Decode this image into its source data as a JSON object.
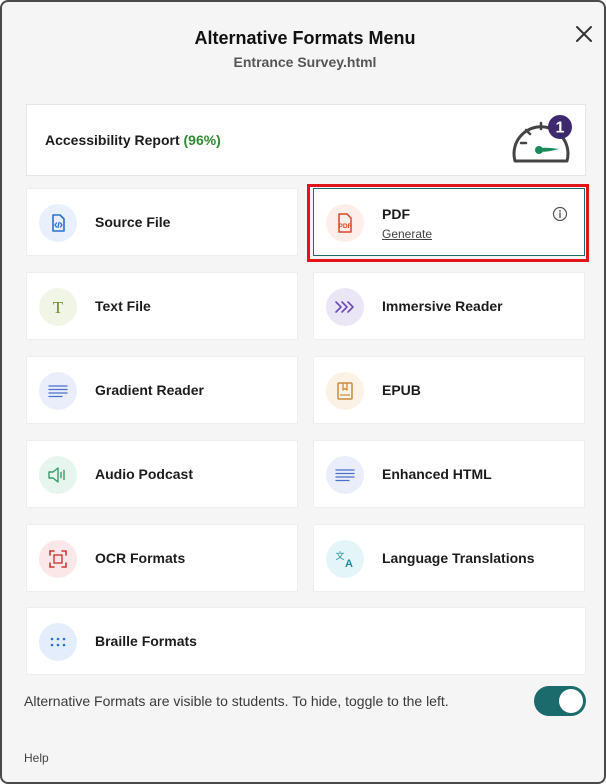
{
  "dialog": {
    "title": "Alternative Formats Menu",
    "subtitle": "Entrance Survey.html",
    "close_icon": "close-icon"
  },
  "report": {
    "label": "Accessibility Report",
    "percent": "(96%)",
    "badge": "1",
    "gauge_icon": "speedometer-icon"
  },
  "formats": {
    "source_file": {
      "label": "Source File",
      "icon": "code-file-icon",
      "color": "#2b6fd6",
      "bg": "#e8f0fb"
    },
    "pdf": {
      "label": "PDF",
      "action": "Generate",
      "icon": "pdf-file-icon",
      "color": "#d6492b",
      "bg": "#fdeee9"
    },
    "text_file": {
      "label": "Text File",
      "icon": "text-t-icon",
      "color": "#6a8a2a",
      "bg": "#f1f5e6"
    },
    "immersive_reader": {
      "label": "Immersive Reader",
      "icon": "chevrons-icon",
      "color": "#6a4cb5",
      "bg": "#ebe6f6"
    },
    "gradient_reader": {
      "label": "Gradient Reader",
      "icon": "lines-icon",
      "color": "#4c6fc7",
      "bg": "#e9eefa"
    },
    "epub": {
      "label": "EPUB",
      "icon": "book-icon",
      "color": "#c98a3a",
      "bg": "#fbf1e4"
    },
    "audio_podcast": {
      "label": "Audio Podcast",
      "icon": "speaker-icon",
      "color": "#3a9a6a",
      "bg": "#e6f5ee"
    },
    "enhanced_html": {
      "label": "Enhanced HTML",
      "icon": "lines-icon",
      "color": "#4c6fc7",
      "bg": "#e9eefa"
    },
    "ocr_formats": {
      "label": "OCR Formats",
      "icon": "scan-frame-icon",
      "color": "#c93a3a",
      "bg": "#fbe7e7"
    },
    "language_translations": {
      "label": "Language Translations",
      "icon": "translate-icon",
      "color": "#1c8a9a",
      "bg": "#e3f5f7"
    },
    "braille_formats": {
      "label": "Braille Formats",
      "icon": "braille-dots-icon",
      "color": "#2b6fd6",
      "bg": "#e3edfb"
    }
  },
  "footer": {
    "visibility_text": "Alternative Formats are visible to students. To hide, toggle to the left.",
    "toggle_on": true,
    "help": "Help"
  },
  "colors": {
    "accent": "#1b6a6c",
    "highlight": "#e0141b",
    "badge": "#3d2a6e",
    "gauge_needle": "#1a8a5a"
  }
}
